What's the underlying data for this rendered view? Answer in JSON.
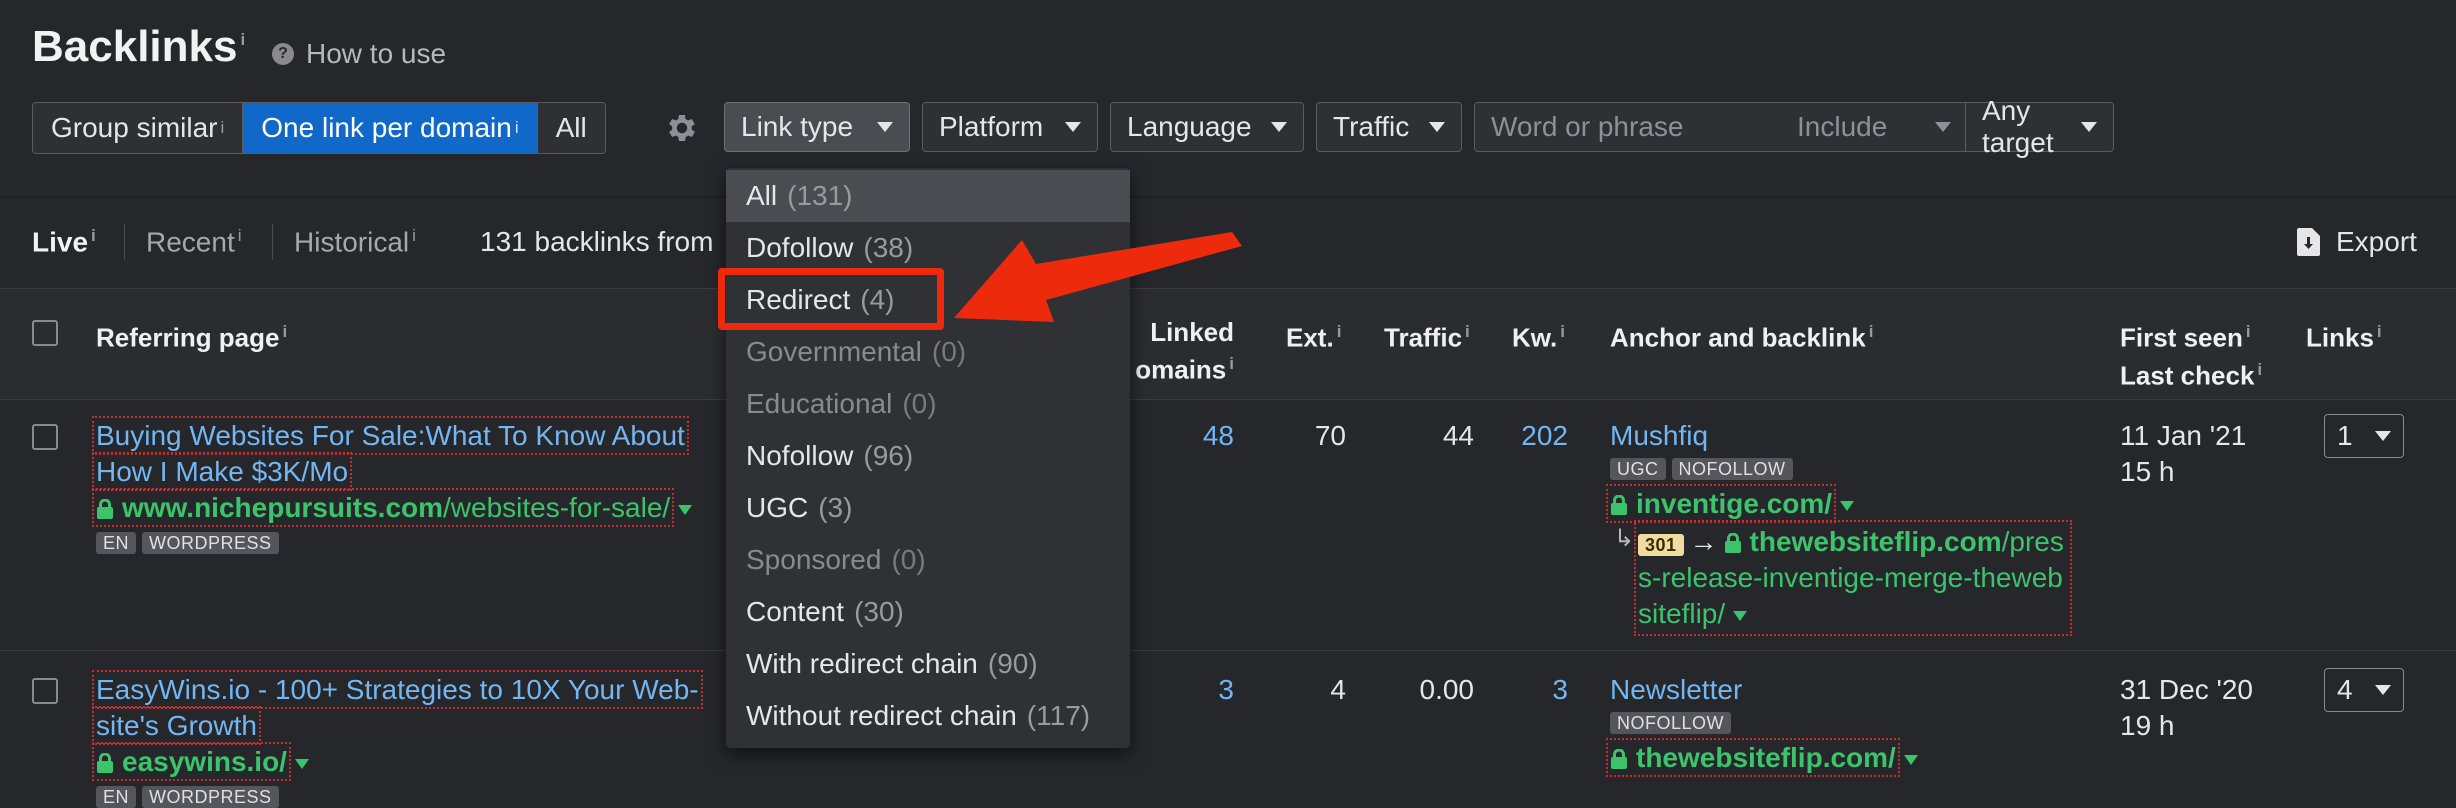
{
  "header": {
    "title": "Backlinks",
    "title_info": "i",
    "how_to_use": "How to use"
  },
  "filters": {
    "group_similar": "Group similar",
    "one_link_per_domain": "One link per domain",
    "all": "All",
    "info": "i",
    "link_type": "Link type",
    "platform": "Platform",
    "language": "Language",
    "traffic": "Traffic",
    "search_placeholder": "Word or phrase",
    "include": "Include",
    "any_target": "Any target"
  },
  "tabs": {
    "live": "Live",
    "recent": "Recent",
    "historical": "Historical",
    "info": "i"
  },
  "summary": "131 backlinks from",
  "export": "Export",
  "table": {
    "headers": {
      "referring_page": "Referring page",
      "linked_domains_1": "Linked",
      "linked_domains_2": "omains",
      "ext": "Ext.",
      "traffic": "Traffic",
      "kw": "Kw.",
      "anchor_backlink": "Anchor and backlink",
      "first_seen": "First seen",
      "last_check": "Last check",
      "links": "Links",
      "info": "i"
    },
    "rows": [
      {
        "title_line1": "Buying Websites For Sale:What To Know About",
        "title_line2": "How I Make $3K/Mo",
        "domain": "www.nichepursuits.com",
        "path": "/websites-for-sale/",
        "tags": [
          "EN",
          "WORDPRESS"
        ],
        "linked_domains": "48",
        "ext": "70",
        "traffic": "44",
        "kw": "202",
        "anchor": "Mushfiq",
        "anchor_tags": [
          "UGC",
          "NOFOLLOW"
        ],
        "backlink_domain": "inventige.com/",
        "redirect_code": "301",
        "redirect_arrow": "→",
        "redirect_line1_domain": "thewebsiteflip.com",
        "redirect_line1_path": "/pres",
        "redirect_line2": "s-release-inventige-merge-theweb",
        "redirect_line3": "siteflip/",
        "first_seen": "11 Jan '21",
        "last_check": "15 h",
        "links": "1"
      },
      {
        "title_line1": "EasyWins.io - 100+ Strategies to 10X Your Web-",
        "title_line2": "site's Growth",
        "domain": "easywins.io/",
        "tags": [
          "EN",
          "WORDPRESS"
        ],
        "linked_domains": "3",
        "ext": "4",
        "traffic": "0.00",
        "kw": "3",
        "anchor": "Newsletter",
        "anchor_tags": [
          "NOFOLLOW"
        ],
        "backlink_domain": "thewebsiteflip.com/",
        "first_seen": "31 Dec '20",
        "last_check": "19 h",
        "links": "4"
      }
    ]
  },
  "dropdown": {
    "options": [
      {
        "label": "All",
        "count": "(131)"
      },
      {
        "label": "Dofollow",
        "count": "(38)"
      },
      {
        "label": "Redirect",
        "count": "(4)"
      },
      {
        "label": "Governmental",
        "count": "(0)"
      },
      {
        "label": "Educational",
        "count": "(0)"
      },
      {
        "label": "Nofollow",
        "count": "(96)"
      },
      {
        "label": "UGC",
        "count": "(3)"
      },
      {
        "label": "Sponsored",
        "count": "(0)"
      },
      {
        "label": "Content",
        "count": "(30)"
      },
      {
        "label": "With redirect chain",
        "count": "(90)"
      },
      {
        "label": "Without redirect chain",
        "count": "(117)"
      }
    ]
  },
  "colors": {
    "accent_blue": "#1068c8",
    "link_blue": "#73b6f2",
    "url_green": "#3bc46b",
    "highlight_red": "#ee2a0d"
  }
}
